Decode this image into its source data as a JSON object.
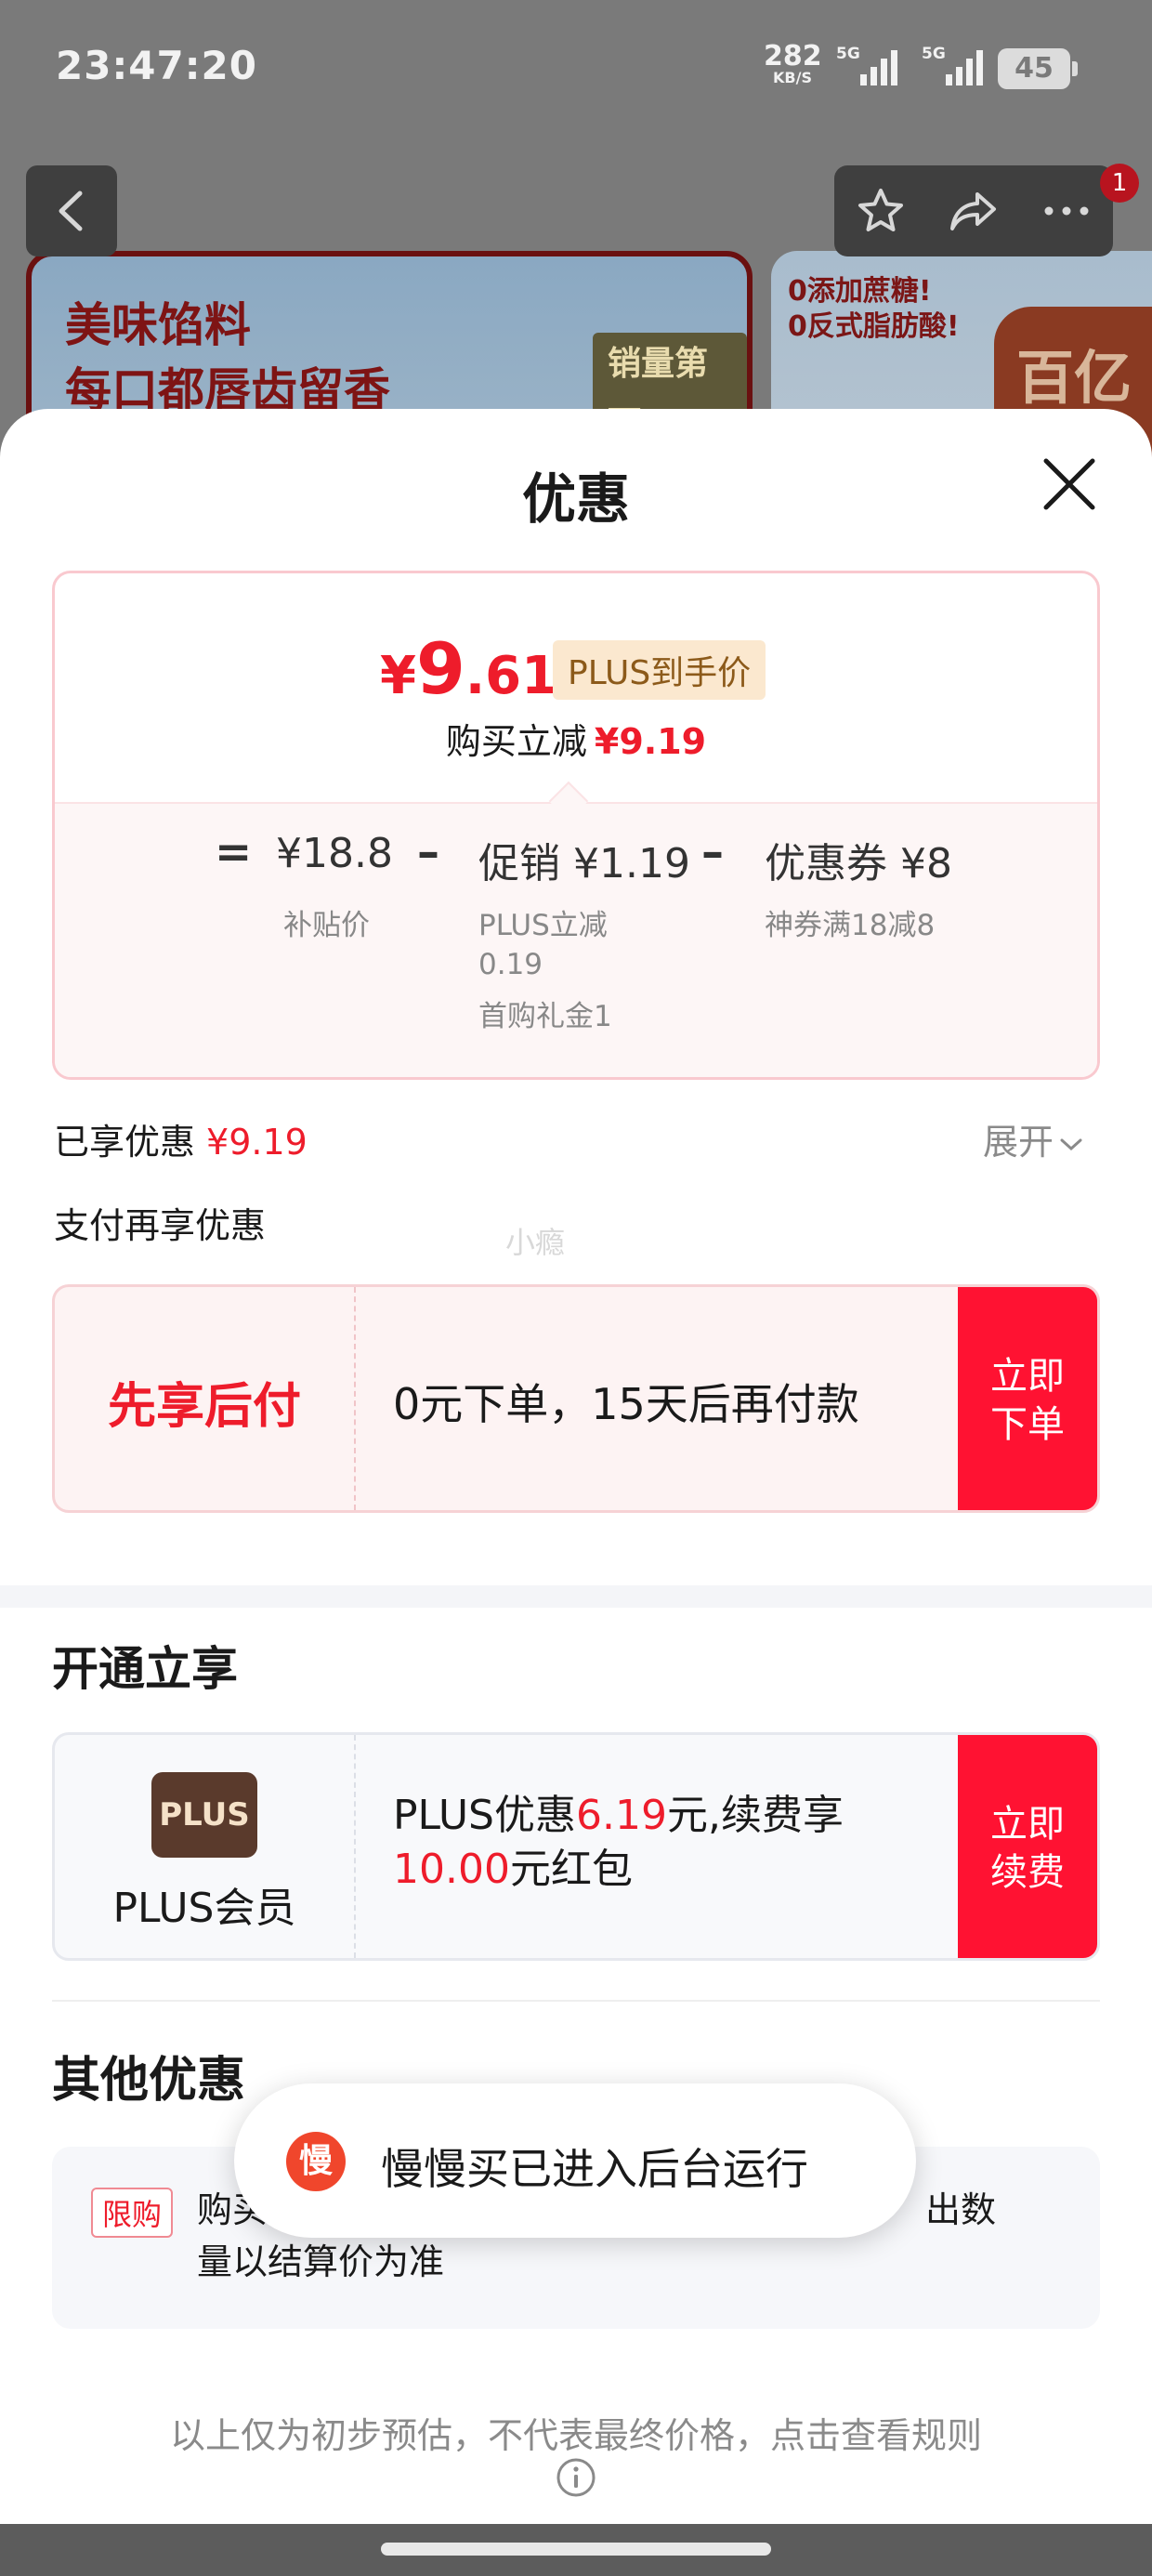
{
  "status_bar": {
    "time": "23:47:20",
    "net_speed": "282",
    "net_unit": "KB/S",
    "signal1_tag": "5G",
    "signal2_tag": "5G",
    "battery": "45"
  },
  "nav": {
    "cart_badge": "1"
  },
  "background_banner": {
    "line1": "美味馅料",
    "line2": "每口都唇齿留香",
    "rank": "销量第一",
    "right_line1": "0添加蔗糖!",
    "right_line2": "0反式脂肪酸!",
    "subsidy": "百亿补贴"
  },
  "sheet": {
    "title": "优惠"
  },
  "price_card": {
    "currency": "¥",
    "price_int": "9",
    "price_dec": ".61",
    "plus_tag": "PLUS到手价",
    "reduce_label": "购买立减",
    "reduce_value": "¥9.19",
    "equals": "=",
    "minus": "–",
    "subsidy_price": "¥18.8",
    "subsidy_label": "补贴价",
    "promo_value": "促销 ¥1.19",
    "promo_detail1": "PLUS立减",
    "promo_detail2": "0.19",
    "promo_detail3": "首购礼金1",
    "coupon_value": "优惠券 ¥8",
    "coupon_detail": "神券满18减8"
  },
  "enjoyed": {
    "label": "已享优惠",
    "value": "¥9.19",
    "expand": "展开"
  },
  "pay": {
    "title": "支付再享优惠",
    "watermark": "小瘾"
  },
  "bnpl": {
    "title": "先享后付",
    "desc": "0元下单，15天后再付款",
    "cta_line1": "立即",
    "cta_line2": "下单"
  },
  "open": {
    "title": "开通立享",
    "logo": "PLUS",
    "name": "PLUS会员",
    "desc_a": "PLUS优惠",
    "desc_b": "6.19",
    "desc_c": "元,续费享",
    "desc_d": "10.00",
    "desc_e": "元红包",
    "cta_line1": "立即",
    "cta_line2": "续费"
  },
  "other": {
    "title": "其他优惠",
    "tag": "限购",
    "text_start": "购买",
    "text_end": "出数",
    "text_line2": "量以结算价为准"
  },
  "toast": {
    "icon_char": "慢",
    "text": "慢慢买已进入后台运行"
  },
  "footer": {
    "note": "以上仅为初步预估，不代表最终价格，点击查看规则"
  },
  "colors": {
    "accent_red": "#ee1c2b",
    "cta_red": "#ff1232",
    "plus_brown": "#5a3a2c"
  }
}
